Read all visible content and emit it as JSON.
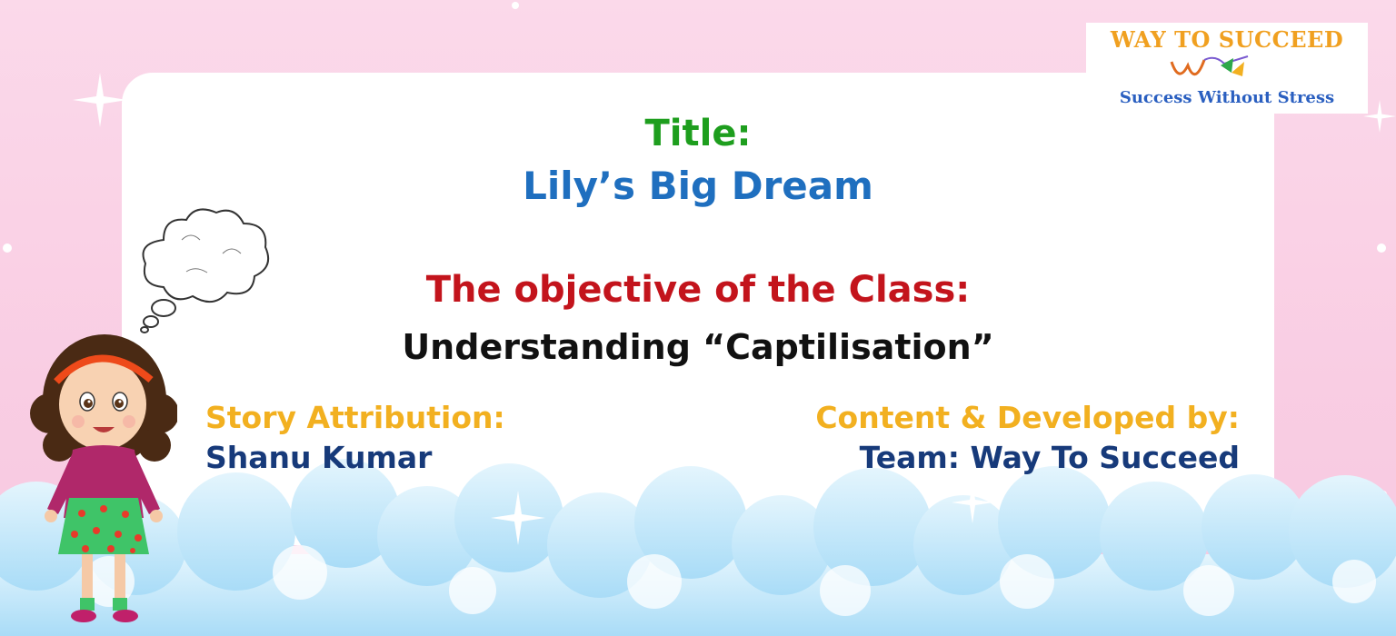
{
  "logo": {
    "name": "WAY TO SUCCEED",
    "tagline": "Success Without Stress"
  },
  "title": {
    "label": "Title:",
    "value": "Lily’s Big Dream"
  },
  "objective": {
    "label": "The objective of the Class:",
    "value": "Understanding “Captilisation”"
  },
  "attribution": {
    "label": "Story Attribution:",
    "value": "Shanu Kumar"
  },
  "credits": {
    "label": "Content & Developed by:",
    "value": "Team: Way To Succeed"
  },
  "colors": {
    "title_label": "#1e9e1e",
    "title_value": "#1f6fbf",
    "objective_label": "#c3141c",
    "objective_value": "#111111",
    "section_label": "#f2b020",
    "section_value": "#173a7a",
    "background": "#f9cde3",
    "clouds": "#bfe6fb"
  },
  "icons": [
    "thought-bubble-icon",
    "girl-illustration",
    "logo-swoosh-icon",
    "sparkle-icon"
  ]
}
